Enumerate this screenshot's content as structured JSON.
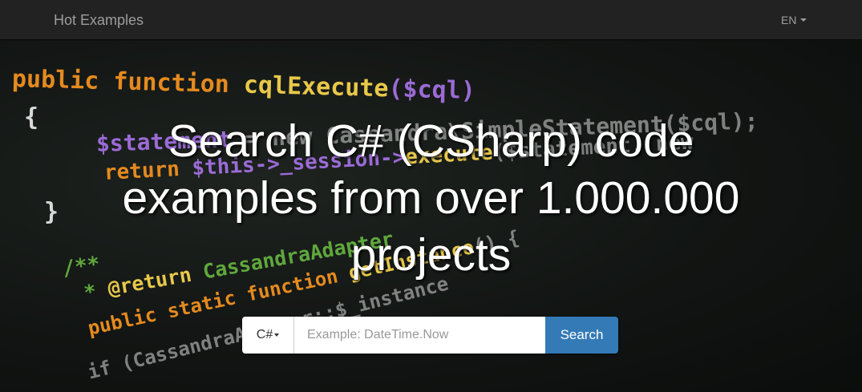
{
  "navbar": {
    "brand": "Hot Examples",
    "language": "EN"
  },
  "hero": {
    "background_code": {
      "line1": {
        "kw1": "public",
        "kw2": "function",
        "fn": "cqlExecute",
        "arg": "($cql)"
      },
      "line2": "{",
      "line3": {
        "var": "$statement",
        "rest": " = new Cassandra\\SimpleStatement($cql);"
      },
      "line4": {
        "kw": "return",
        "rest": " $this->_session->",
        "fn": "execute",
        "tail": "($statement, new"
      },
      "line5": "}",
      "line6": "/**",
      "line7": {
        "star": "* ",
        "tag": "@return",
        "rest": " CassandraAdapter"
      },
      "line8": {
        "kw": "public static function",
        "fn": " getInstance",
        "tail": "() {"
      },
      "line9": "if (CassandraAdapter::$_instance"
    },
    "title": "Search C# (CSharp) code examples from over 1.000.000 projects"
  },
  "search": {
    "language_selector": "C#",
    "placeholder": "Example: DateTime.Now",
    "value": "",
    "button_label": "Search"
  },
  "colors": {
    "navbar_bg": "#222222",
    "navbar_text": "#9d9d9d",
    "search_button": "#337ab7",
    "title_text": "#ffffff"
  },
  "icons": [
    "caret-down-icon"
  ]
}
